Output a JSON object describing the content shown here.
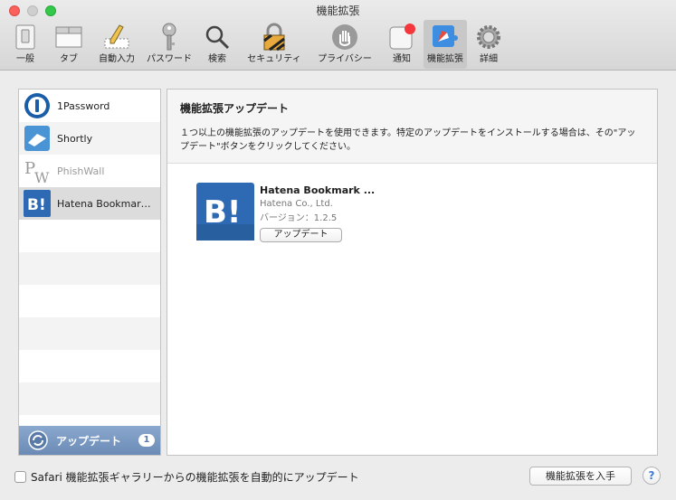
{
  "window": {
    "title": "機能拡張"
  },
  "toolbar": {
    "items": [
      {
        "label": "一般"
      },
      {
        "label": "タブ"
      },
      {
        "label": "自動入力"
      },
      {
        "label": "パスワード"
      },
      {
        "label": "検索"
      },
      {
        "label": "セキュリティ"
      },
      {
        "label": "プライバシー"
      },
      {
        "label": "通知"
      },
      {
        "label": "機能拡張"
      },
      {
        "label": "詳細"
      }
    ],
    "selected": "機能拡張"
  },
  "extensions": [
    {
      "name": "1Password",
      "enabled": true
    },
    {
      "name": "Shortly",
      "enabled": true
    },
    {
      "name": "PhishWall",
      "enabled": false
    },
    {
      "name": "Hatena Bookmark ...",
      "enabled": true,
      "selected": true
    }
  ],
  "updates_bar": {
    "label": "アップデート",
    "count": "1"
  },
  "panel": {
    "title": "機能拡張アップデート",
    "description": "１つ以上の機能拡張のアップデートを使用できます。特定のアップデートをインストールする場合は、その\"アップデート\"ボタンをクリックしてください。",
    "update_item": {
      "name": "Hatena Bookmark ...",
      "developer": "Hatena Co., Ltd.",
      "version": "バージョン：1.2.5",
      "button": "アップデート"
    }
  },
  "bottom": {
    "auto_update_label": "Safari 機能拡張ギャラリーからの機能拡張を自動的にアップデート",
    "get_extensions_button": "機能拡張を入手",
    "help_button": "?"
  },
  "colors": {
    "accent": "#6b8bb6",
    "hatena_blue": "#2e6ab3",
    "notification_red": "#f5373b"
  }
}
